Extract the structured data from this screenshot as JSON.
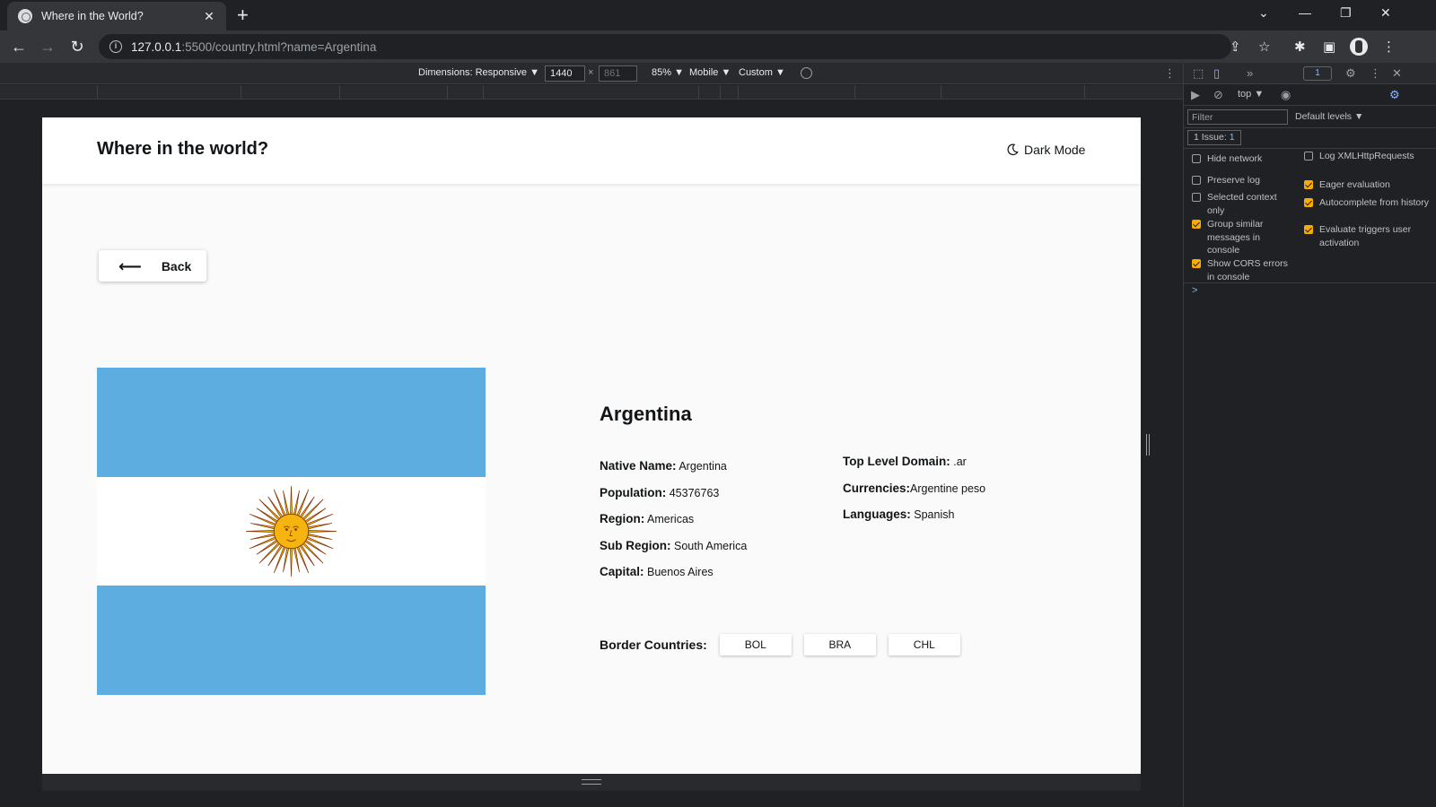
{
  "browser": {
    "tab_title": "Where in the World?",
    "url_host": "127.0.0.1",
    "url_path": ":5500/country.html?name=Argentina"
  },
  "device_toolbar": {
    "dimensions": "Dimensions: Responsive ▼",
    "width": "1440",
    "height": "861",
    "zoom": "85% ▼",
    "throttle": "Mobile ▼",
    "custom": "Custom ▼"
  },
  "page": {
    "brand": "Where in the world?",
    "dark_mode": "Dark Mode",
    "back": "Back",
    "country": {
      "name": "Argentina",
      "native_name_label": "Native Name:",
      "native_name": "Argentina",
      "population_label": "Population:",
      "population": "45376763",
      "region_label": "Region:",
      "region": "Americas",
      "sub_region_label": "Sub Region:",
      "sub_region": "South America",
      "capital_label": "Capital:",
      "capital": "Buenos Aires",
      "tld_label": "Top Level Domain:",
      "tld": ".ar",
      "currencies_label": "Currencies:",
      "currencies": "Argentine peso",
      "languages_label": "Languages:",
      "languages": "Spanish",
      "border_label": "Border Countries:",
      "borders": [
        "BOL",
        "BRA",
        "CHL"
      ]
    },
    "flag_colors": {
      "blue": "#5dade0",
      "white": "#ffffff",
      "sun": "#f6b40e",
      "sun_outline": "#85340a"
    }
  },
  "devtools": {
    "context": "top ▼",
    "filter_placeholder": "Filter",
    "levels": "Default levels ▼",
    "issues_label": "1 Issue:",
    "issues_count": "1",
    "badge": "1",
    "options_left": [
      {
        "label": "Hide network",
        "checked": false
      },
      {
        "label": "Preserve log",
        "checked": false
      },
      {
        "label": "Selected context only",
        "checked": false
      },
      {
        "label": "Group similar messages in console",
        "checked": true
      },
      {
        "label": "Show CORS errors in console",
        "checked": true
      }
    ],
    "options_right": [
      {
        "label": "Log XMLHttpRequests",
        "checked": false
      },
      {
        "label": "Eager evaluation",
        "checked": true
      },
      {
        "label": "Autocomplete from history",
        "checked": true
      },
      {
        "label": "Evaluate triggers user activation",
        "checked": true
      }
    ],
    "prompt": ">"
  }
}
